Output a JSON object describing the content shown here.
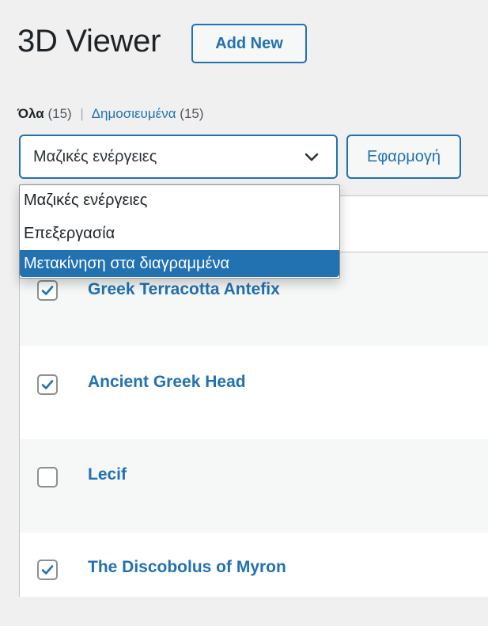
{
  "page": {
    "title": "3D Viewer",
    "add_new_label": "Add New"
  },
  "filters": {
    "all_label": "Όλα",
    "all_count": "(15)",
    "separator": "|",
    "published_label": "Δημοσιευμένα",
    "published_count": "(15)"
  },
  "bulk_actions": {
    "selected": "Μαζικές ενέργειες",
    "apply_label": "Εφαρμογή",
    "options": [
      "Μαζικές ενέργειες",
      "Επεξεργασία",
      "Μετακίνηση στα διαγραμμένα"
    ],
    "highlighted_index": 2
  },
  "rows": [
    {
      "title": "Greek Terracotta Antefix",
      "checked": true
    },
    {
      "title": "Ancient Greek Head",
      "checked": true
    },
    {
      "title": "Lecif",
      "checked": false
    },
    {
      "title": "The Discobolus of Myron",
      "checked": true
    }
  ],
  "colors": {
    "accent": "#2271b1",
    "checkmark": "#2271b1"
  }
}
